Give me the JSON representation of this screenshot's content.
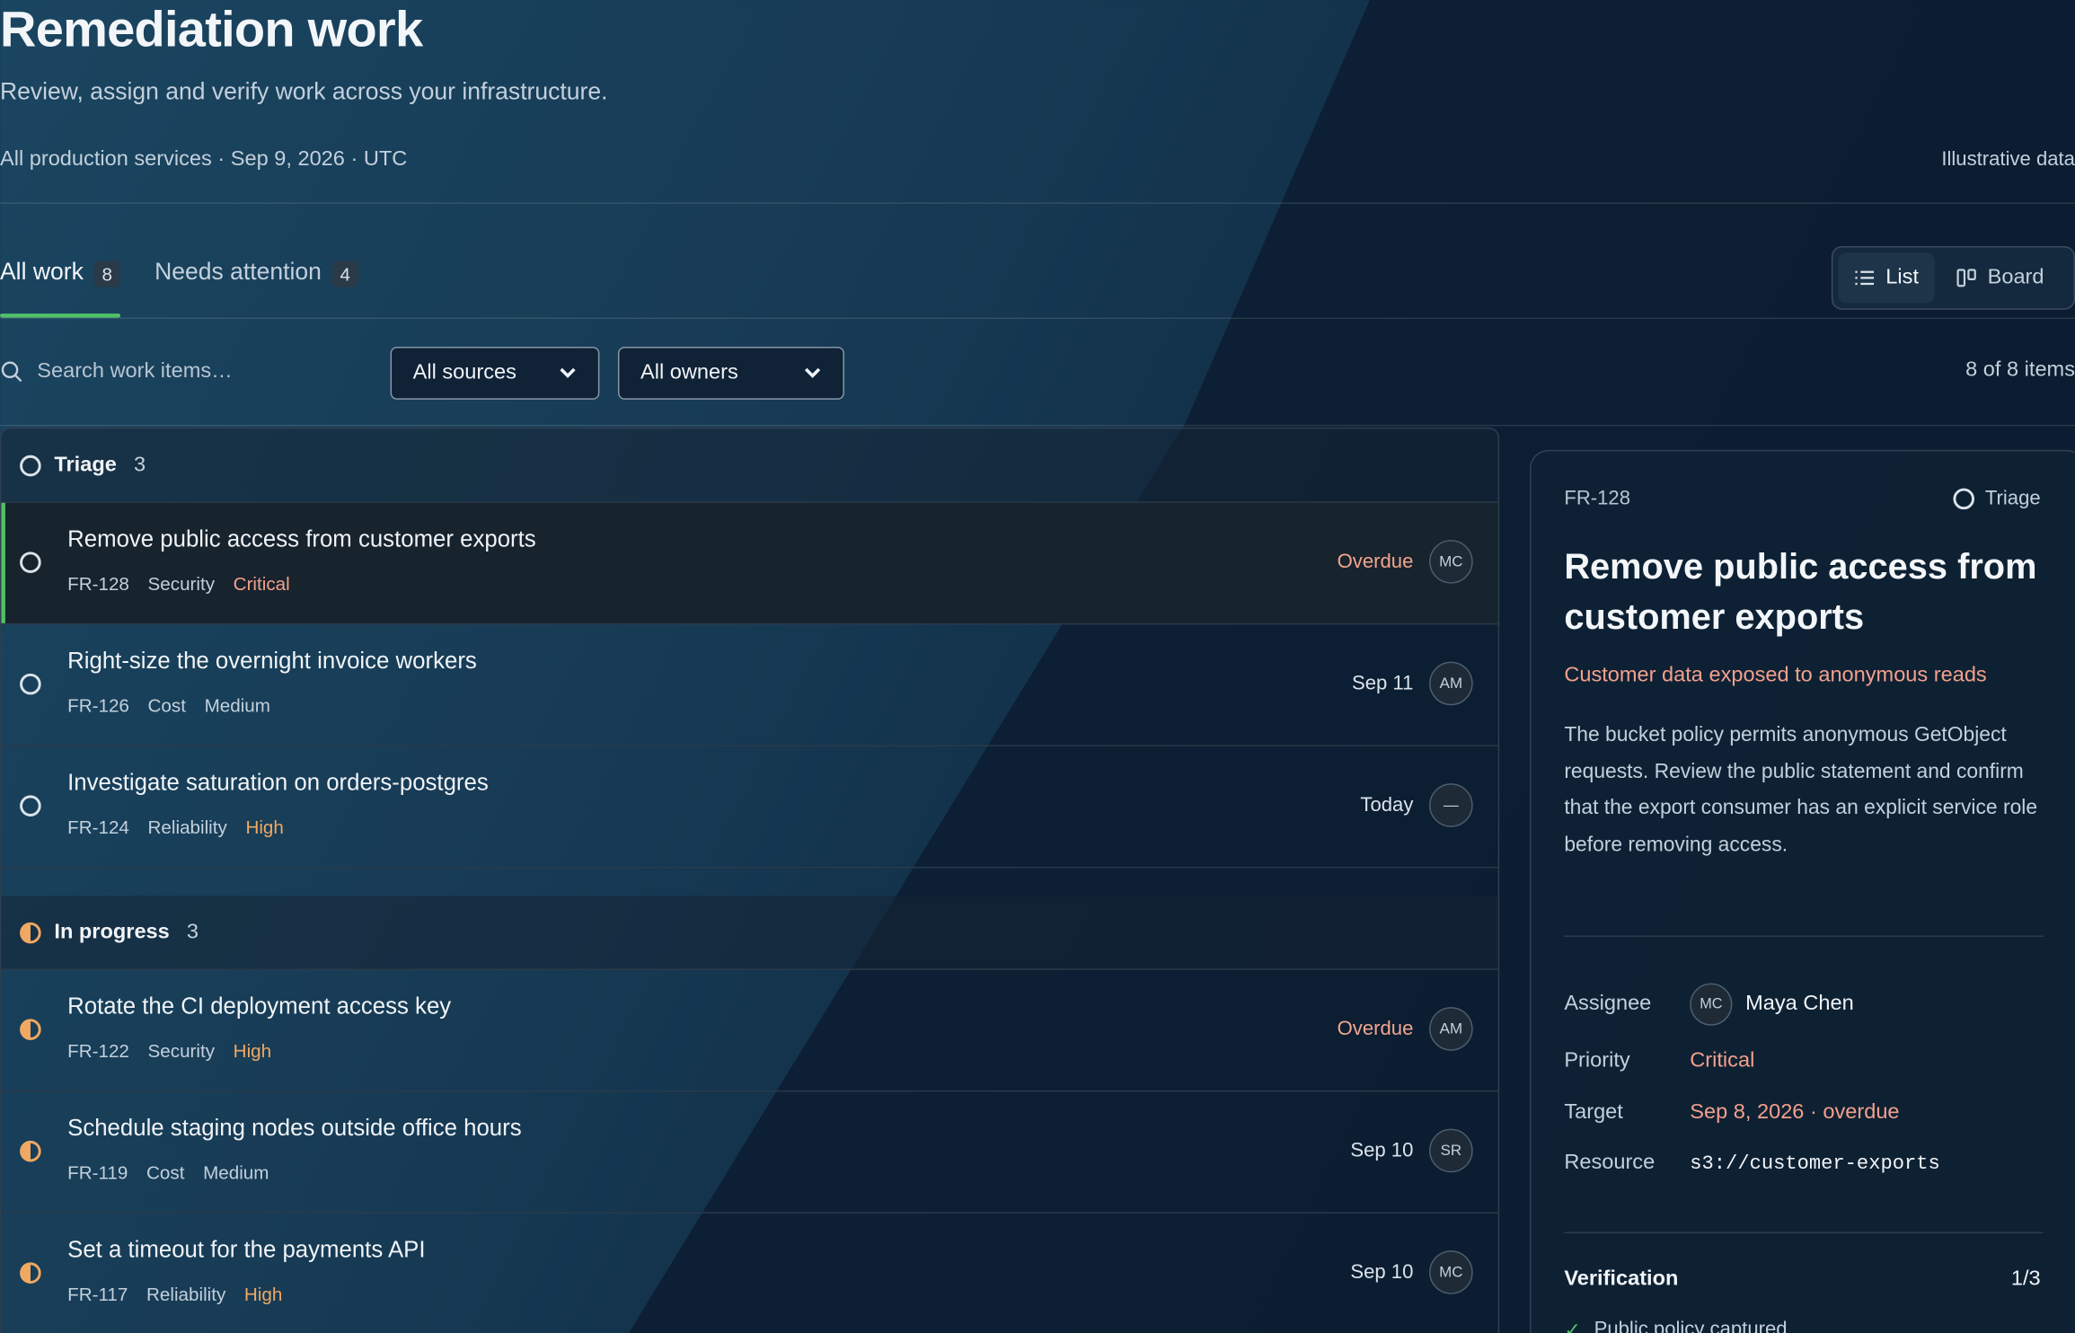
{
  "header": {
    "title": "Remediation work",
    "subtitle": "Review, assign and verify work across your infrastructure.",
    "scope": "All production services · Sep 9, 2026 · UTC",
    "note": "Illustrative data"
  },
  "tabs": [
    {
      "label": "All work",
      "count": "8",
      "active": true
    },
    {
      "label": "Needs attention",
      "count": "4",
      "active": false
    }
  ],
  "view_toggle": {
    "list": "List",
    "board": "Board",
    "selected": "List"
  },
  "filters": {
    "search_placeholder": "Search work items…",
    "sources": "All sources",
    "owners": "All owners",
    "count": "8 of 8 items"
  },
  "groups": [
    {
      "name": "Triage",
      "count": "3",
      "icon": "circle-outline-icon",
      "items": [
        {
          "title": "Remove public access from customer exports",
          "id": "FR-128",
          "category": "Security",
          "priority": "Critical",
          "due": "Overdue",
          "owner": "MC"
        },
        {
          "title": "Right-size the overnight invoice workers",
          "id": "FR-126",
          "category": "Cost",
          "priority": "Medium",
          "due": "Sep 11",
          "owner": "AM"
        },
        {
          "title": "Investigate saturation on orders-postgres",
          "id": "FR-124",
          "category": "Reliability",
          "priority": "High",
          "due": "Today",
          "owner": "—"
        }
      ]
    },
    {
      "name": "In progress",
      "count": "3",
      "icon": "half-circle-icon",
      "items": [
        {
          "title": "Rotate the CI deployment access key",
          "id": "FR-122",
          "category": "Security",
          "priority": "High",
          "due": "Overdue",
          "owner": "AM"
        },
        {
          "title": "Schedule staging nodes outside office hours",
          "id": "FR-119",
          "category": "Cost",
          "priority": "Medium",
          "due": "Sep 10",
          "owner": "SR"
        },
        {
          "title": "Set a timeout for the payments API",
          "id": "FR-117",
          "category": "Reliability",
          "priority": "High",
          "due": "Sep 10",
          "owner": "MC"
        }
      ]
    }
  ],
  "detail": {
    "id": "FR-128",
    "status": "Triage",
    "title": "Remove public access from customer exports",
    "summary": "Customer data exposed to anonymous reads",
    "description": "The bucket policy permits anonymous GetObject requests. Review the public statement and confirm that the export consumer has an explicit service role before removing access.",
    "fields": {
      "assignee_label": "Assignee",
      "assignee_initials": "MC",
      "assignee": "Maya Chen",
      "priority_label": "Priority",
      "priority": "Critical",
      "target_label": "Target",
      "target": "Sep 8, 2026 · overdue",
      "resource_label": "Resource",
      "resource": "s3://customer-exports"
    },
    "verification": {
      "label": "Verification",
      "progress": "1/3",
      "first_check": "Public policy captured"
    }
  },
  "colors": {
    "accent": "#52c169",
    "critical": "#f3a08c",
    "high": "#f0a862",
    "background": "#173a54"
  }
}
